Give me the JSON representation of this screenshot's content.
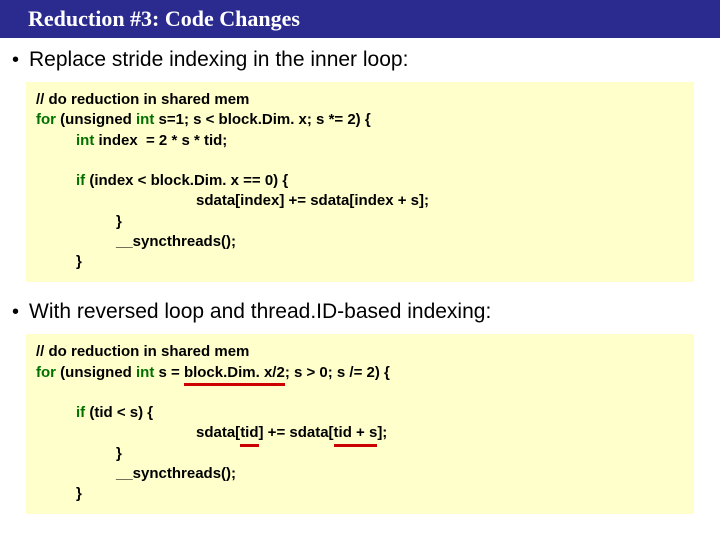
{
  "title": "Reduction #3: Code Changes",
  "bullet1": "Replace stride indexing in the inner loop:",
  "bullet2": "With reversed loop and thread.ID-based indexing:",
  "code1": {
    "l1": "// do reduction in shared mem",
    "l2a": "for",
    "l2b": " (unsigned ",
    "l2c": "int",
    "l2d": " s=1; s < block.Dim. x; s *= 2) {",
    "l3a": "int",
    "l3b": " index  = 2 * s * tid;",
    "l4a": "if",
    "l4b": " (index < block.Dim. x == 0) {",
    "l5": "sdata[index] += sdata[index + s];",
    "l6": "}",
    "l7": "__syncthreads();",
    "l8": "}"
  },
  "code2": {
    "l1": "// do reduction in shared mem",
    "l2a": "for",
    "l2b": " (unsigned ",
    "l2c": "int",
    "l2d": " s = ",
    "l2e": "block.Dim. x/2",
    "l2f": "; s > 0; s /= 2) {",
    "l3a": "if",
    "l3b": " (tid < s) {",
    "l4a": "sdata[",
    "l4b": "tid",
    "l4c": "] += sdata[",
    "l4d": "tid + s",
    "l4e": "];",
    "l5": "}",
    "l6": "__syncthreads();",
    "l7": "}"
  }
}
